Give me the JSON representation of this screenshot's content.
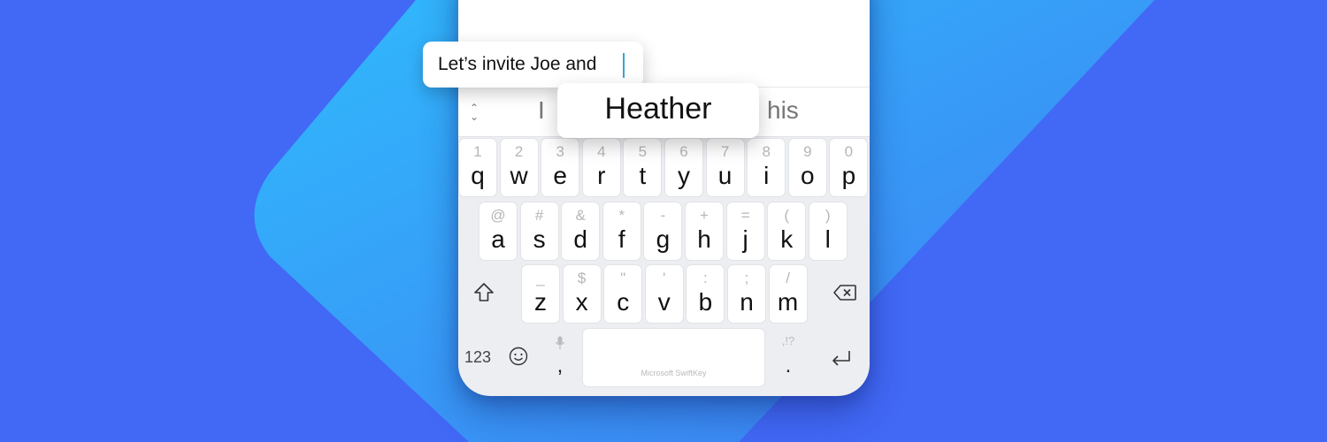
{
  "theme": {
    "background": "#4268f6",
    "shape_gradient_start": "#33b6fb",
    "shape_gradient_end": "#3f7ff3",
    "keyboard_bg": "#eceef2",
    "caret_color": "#3aa3d8"
  },
  "text_bubble": {
    "text": "Let’s invite Joe and"
  },
  "prediction_bar": {
    "collapse_icon": "⌃⌄",
    "left": "I",
    "center": "Heather",
    "right": "his"
  },
  "keyboard": {
    "row1": [
      {
        "sec": "1",
        "pri": "q"
      },
      {
        "sec": "2",
        "pri": "w"
      },
      {
        "sec": "3",
        "pri": "e"
      },
      {
        "sec": "4",
        "pri": "r"
      },
      {
        "sec": "5",
        "pri": "t"
      },
      {
        "sec": "6",
        "pri": "y"
      },
      {
        "sec": "7",
        "pri": "u"
      },
      {
        "sec": "8",
        "pri": "i"
      },
      {
        "sec": "9",
        "pri": "o"
      },
      {
        "sec": "0",
        "pri": "p"
      }
    ],
    "row2": [
      {
        "sec": "@",
        "pri": "a"
      },
      {
        "sec": "#",
        "pri": "s"
      },
      {
        "sec": "&",
        "pri": "d"
      },
      {
        "sec": "*",
        "pri": "f"
      },
      {
        "sec": "-",
        "pri": "g"
      },
      {
        "sec": "+",
        "pri": "h"
      },
      {
        "sec": "=",
        "pri": "j"
      },
      {
        "sec": "(",
        "pri": "k"
      },
      {
        "sec": ")",
        "pri": "l"
      }
    ],
    "row3": [
      {
        "sec": "_",
        "pri": "z"
      },
      {
        "sec": "$",
        "pri": "x"
      },
      {
        "sec": "\"",
        "pri": "c"
      },
      {
        "sec": "'",
        "pri": "v"
      },
      {
        "sec": ":",
        "pri": "b"
      },
      {
        "sec": ";",
        "pri": "n"
      },
      {
        "sec": "/",
        "pri": "m"
      }
    ],
    "numbers_label": "123",
    "comma_label": ",",
    "period_label": ".",
    "period_secondary": ",!?",
    "space_label": "Microsoft SwiftKey"
  }
}
